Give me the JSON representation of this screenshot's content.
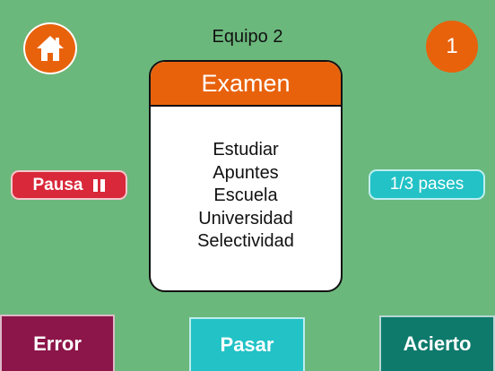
{
  "colors": {
    "background": "#6bb87c",
    "orange": "#e8620c",
    "pause": "#d8283a",
    "teal": "#22c2c6",
    "error": "#8c1549",
    "success": "#0e7a6c"
  },
  "header": {
    "team_name": "Equipo 2",
    "score": "1",
    "home_icon": "home-icon"
  },
  "card": {
    "title": "Examen",
    "forbidden_words": [
      "Estudiar",
      "Apuntes",
      "Escuela",
      "Universidad",
      "Selectividad"
    ]
  },
  "controls": {
    "pause_label": "Pausa",
    "pause_icon": "pause-icon",
    "passes": "1/3 pases"
  },
  "actions": {
    "error_label": "Error",
    "pass_label": "Pasar",
    "success_label": "Acierto"
  }
}
